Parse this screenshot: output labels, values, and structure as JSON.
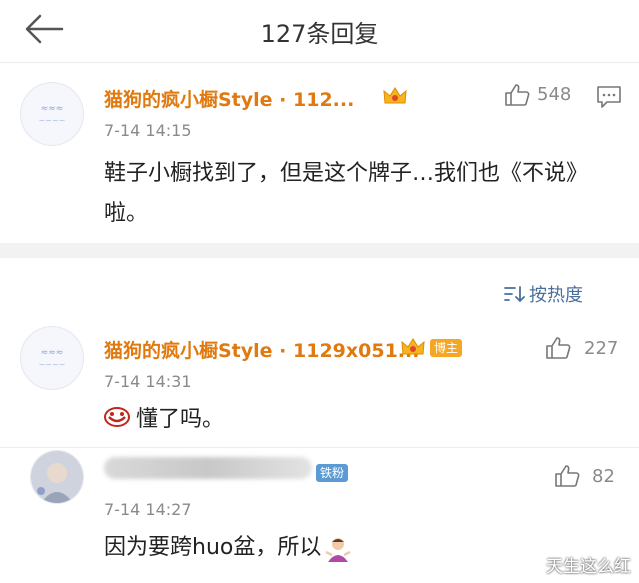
{
  "header": {
    "title": "127条回复"
  },
  "main_comment": {
    "username": "猫狗的疯小橱Style · 112...",
    "time": "7-14 14:15",
    "likes": "548",
    "text": "鞋子小橱找到了，但是这个牌子…我们也《不说》啦。"
  },
  "sort": {
    "label": "按热度"
  },
  "replies": [
    {
      "username": "猫狗的疯小橱Style · 1129x051...",
      "badge": "博主",
      "time": "7-14 14:31",
      "likes": "227",
      "text": "懂了吗。"
    },
    {
      "username": "",
      "badge": "铁粉",
      "time": "7-14 14:27",
      "likes": "82",
      "text": "因为要跨huo盆，所以"
    }
  ],
  "watermark": "天生这么红",
  "colors": {
    "username": "#e07a10",
    "link": "#4a6f9c",
    "band": "#f2f2f2"
  }
}
